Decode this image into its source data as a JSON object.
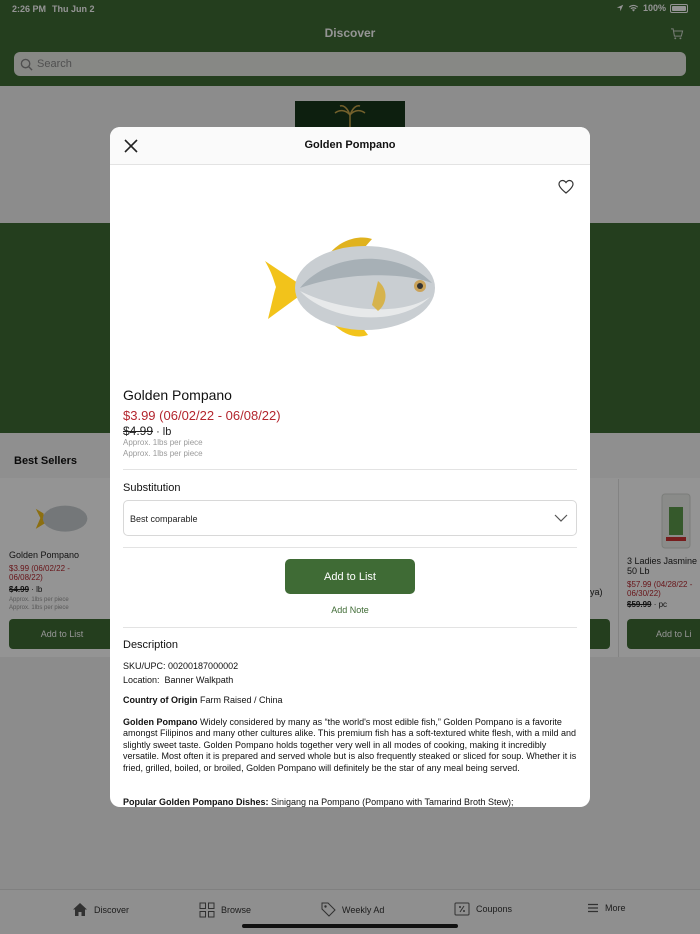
{
  "status_bar": {
    "time": "2:26 PM",
    "date": "Thu Jun 2",
    "battery": "100%"
  },
  "nav": {
    "title": "Discover",
    "search_placeholder": "Search"
  },
  "best_sellers": {
    "title": "Best Sellers",
    "cards": [
      {
        "name": "Golden Pompano",
        "price": "$3.99 (06/02/22 - 06/08/22)",
        "old_price": "$4.99",
        "unit": " · lb",
        "approx1": "Approx. 1lbs per piece",
        "approx2": "Approx. 1lbs per piece",
        "button": "Add to List"
      },
      {
        "name": "3 Ladies Jasmine 50 Lb",
        "price": "$57.99 (04/28/22 - 06/30/22)",
        "old_price": "$59.99",
        "unit": " · pc",
        "button": "Add to Li"
      }
    ],
    "partial_text": "ya)"
  },
  "modal": {
    "title": "Golden Pompano",
    "product_name": "Golden Pompano",
    "price": "$3.99",
    "price_dates": "(06/02/22 - 06/08/22)",
    "old_price": "$4.99",
    "unit": " · lb",
    "approx1": "Approx. 1lbs per piece",
    "approx2": "Approx. 1lbs per piece",
    "substitution_label": "Substitution",
    "substitution_value": "Best comparable",
    "add_button": "Add to List",
    "add_note": "Add Note",
    "description_title": "Description",
    "sku_label": "SKU/UPC:",
    "sku_value": " 00200187000002",
    "location_label": "Location:",
    "location_value": "  Banner Walkpath",
    "origin_label": "Country of Origin",
    "origin_value": " Farm Raised / China",
    "description_bold": "Golden Pompano",
    "description_text": " Widely considered by many as “the world's most edible fish,” Golden Pompano is a favorite amongst Filipinos and many other cultures alike. This premium fish has a soft-textured white flesh, with a mild and slightly sweet taste. Golden Pompano holds together very well in all modes of cooking, making it incredibly versatile. Most often it is prepared and served whole but is also frequently steaked or sliced for soup. Whether it is fried, grilled, boiled, or broiled, Golden Pompano will definitely be the star of any meal being served.",
    "dishes_label": "Popular Golden Pompano Dishes:",
    "dishes_value": " Sinigang na Pompano (Pompano with Tamarind Broth Stew);"
  },
  "tabs": [
    {
      "label": "Discover",
      "icon": "home-icon"
    },
    {
      "label": "Browse",
      "icon": "grid-icon"
    },
    {
      "label": "Weekly Ad",
      "icon": "tag-icon"
    },
    {
      "label": "Coupons",
      "icon": "coupon-icon"
    },
    {
      "label": "More",
      "icon": "menu-icon"
    }
  ],
  "colors": {
    "brand_green": "#3f6b35",
    "sale_red": "#b3262e"
  }
}
